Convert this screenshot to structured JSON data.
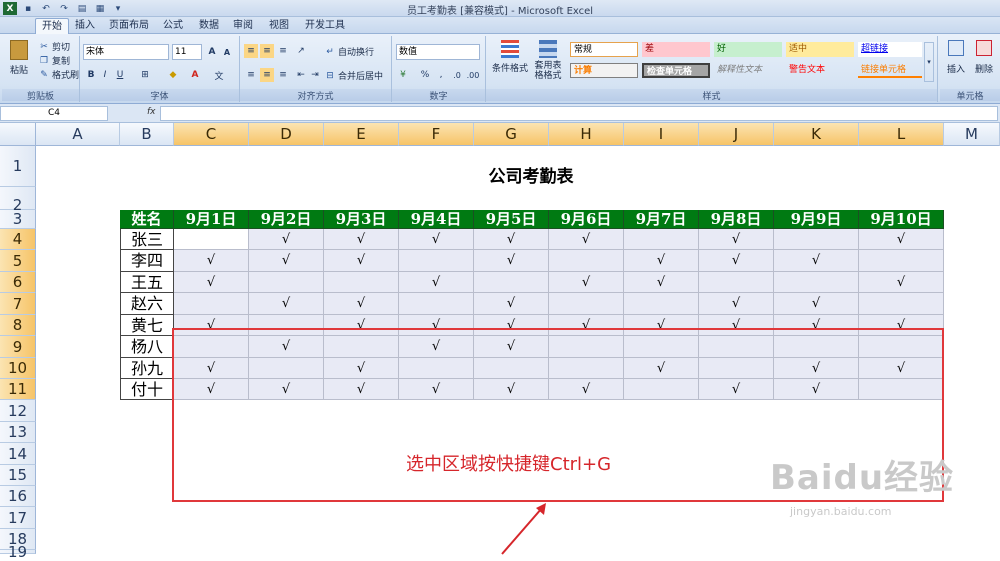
{
  "window": {
    "title": "员工考勤表 [兼容模式] - Microsoft Excel"
  },
  "menu": {
    "tabs": [
      "开始",
      "插入",
      "页面布局",
      "公式",
      "数据",
      "审阅",
      "视图",
      "开发工具"
    ]
  },
  "ribbon": {
    "clipboard": {
      "paste": "粘贴",
      "cut": "剪切",
      "copy": "复制",
      "format_painter": "格式刷",
      "label": "剪贴板"
    },
    "font": {
      "name": "宋体",
      "size": "11",
      "label": "字体",
      "bold": "B",
      "italic": "I",
      "underline": "U"
    },
    "alignment": {
      "wrap": "自动换行",
      "merge": "合并后居中",
      "label": "对齐方式"
    },
    "number": {
      "format": "数值",
      "label": "数字",
      "percent": "%",
      "comma": ","
    },
    "styles": {
      "conditional": "条件格式",
      "table": "套用表格格式",
      "label": "样式",
      "cells": [
        "常规",
        "差",
        "好",
        "适中",
        "超链接",
        "计算",
        "检查单元格",
        "解释性文本",
        "警告文本",
        "链接单元格"
      ]
    },
    "cells": {
      "insert": "插入",
      "delete": "删除",
      "label": "单元格"
    }
  },
  "formula_bar": {
    "name_box": "C4",
    "fx": "fx",
    "value": ""
  },
  "columns": [
    "A",
    "B",
    "C",
    "D",
    "E",
    "F",
    "G",
    "H",
    "I",
    "J",
    "K",
    "L",
    "M"
  ],
  "rows": [
    "1",
    "2",
    "3",
    "4",
    "5",
    "6",
    "7",
    "8",
    "9",
    "10",
    "11",
    "12",
    "13",
    "14",
    "15",
    "16",
    "17",
    "18",
    "19"
  ],
  "sheet": {
    "title": "公司考勤表",
    "header_name": "姓名",
    "dates": [
      "9月1日",
      "9月2日",
      "9月3日",
      "9月4日",
      "9月5日",
      "9月6日",
      "9月7日",
      "9月8日",
      "9月9日",
      "9月10日"
    ],
    "check": "√",
    "employees": [
      {
        "name": "张三",
        "marks": [
          0,
          1,
          1,
          1,
          1,
          1,
          0,
          1,
          0,
          1
        ]
      },
      {
        "name": "李四",
        "marks": [
          1,
          1,
          1,
          0,
          1,
          0,
          1,
          1,
          1,
          0
        ]
      },
      {
        "name": "王五",
        "marks": [
          1,
          0,
          0,
          1,
          0,
          1,
          1,
          0,
          0,
          1
        ]
      },
      {
        "name": "赵六",
        "marks": [
          0,
          1,
          1,
          0,
          1,
          0,
          0,
          1,
          1,
          0
        ]
      },
      {
        "name": "黄七",
        "marks": [
          1,
          0,
          1,
          1,
          1,
          1,
          1,
          1,
          1,
          1
        ]
      },
      {
        "name": "杨八",
        "marks": [
          0,
          1,
          0,
          1,
          1,
          0,
          0,
          0,
          0,
          0
        ]
      },
      {
        "name": "孙九",
        "marks": [
          1,
          0,
          1,
          0,
          0,
          0,
          1,
          0,
          1,
          1
        ]
      },
      {
        "name": "付十",
        "marks": [
          1,
          1,
          1,
          1,
          1,
          1,
          0,
          1,
          1,
          0
        ]
      }
    ]
  },
  "annotation": {
    "text": "选中区域按快捷键Ctrl+G",
    "color": "#d6262b"
  },
  "watermark": {
    "brand": "Baidu经验",
    "url": "jingyan.baidu.com"
  },
  "colors": {
    "header_green": "#007a12",
    "selection_red": "#e0383b",
    "selected_fill": "#e8eaf5"
  }
}
